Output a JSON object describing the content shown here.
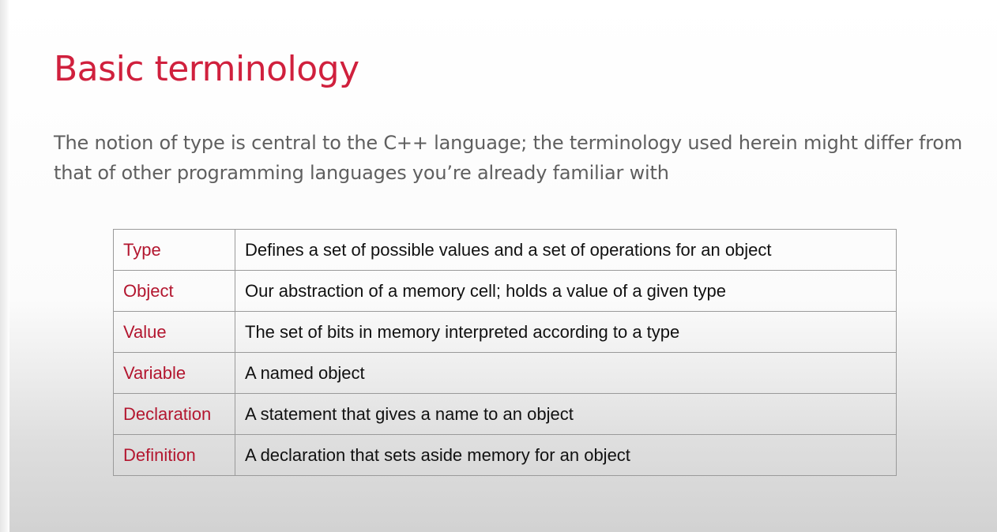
{
  "slide": {
    "title": "Basic terminology",
    "intro": "The notion of type is central to the C++ language; the terminology used herein might differ from that of other programming languages you’re already familiar with"
  },
  "table": {
    "rows": [
      {
        "term": "Type",
        "definition": "Defines a set of possible values and a set of operations for an object"
      },
      {
        "term": "Object",
        "definition": "Our abstraction of a memory cell; holds a value of a given type"
      },
      {
        "term": "Value",
        "definition": "The set of bits in memory interpreted according to a type"
      },
      {
        "term": "Variable",
        "definition": "A named object"
      },
      {
        "term": "Declaration",
        "definition": "A statement that gives a name to an object"
      },
      {
        "term": "Definition",
        "definition": "A declaration that sets aside memory for an object"
      }
    ]
  },
  "colors": {
    "accent": "#d0203d",
    "term_text": "#b3162f",
    "intro_text": "#5f5f5f",
    "border": "#9a9a9a"
  }
}
